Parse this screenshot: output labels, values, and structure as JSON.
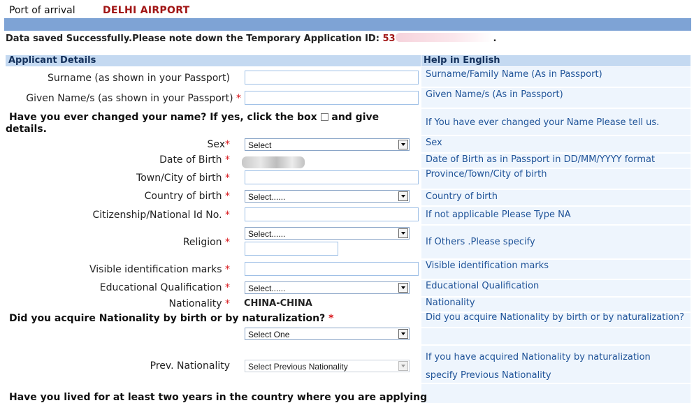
{
  "header": {
    "port_label": "Port of arrival",
    "port_value": "DELHI AIRPORT"
  },
  "notice": {
    "message": "Data saved Successfully.Please note down the Temporary Application ID:",
    "application_id_visible": "53",
    "application_id_end": "."
  },
  "sections": {
    "applicant": "Applicant Details",
    "help": "Help in English"
  },
  "required_mark": "*",
  "fields": {
    "surname": {
      "label": "Surname (as shown in your Passport)",
      "value": "",
      "help": "Surname/Family Name (As in Passport)"
    },
    "given_name": {
      "label": "Given Name/s (as shown in your Passport)",
      "value": "",
      "help": "Given Name/s (As in Passport)"
    },
    "changed_name": {
      "question_line1": "Have you ever changed your name? If yes, click the box",
      "question_tail": "and give",
      "question_line2": "details.",
      "help": "If You have ever changed your Name Please tell us."
    },
    "sex": {
      "label": "Sex",
      "selected": "Select",
      "help": "Sex"
    },
    "dob": {
      "label": "Date of Birth",
      "help": "Date of Birth as in Passport in DD/MM/YYYY format"
    },
    "birth_city": {
      "label": "Town/City of birth",
      "value": "",
      "help": "Province/Town/City of birth"
    },
    "birth_country": {
      "label": "Country of birth",
      "selected": "Select......",
      "help": "Country of birth"
    },
    "national_id": {
      "label": "Citizenship/National Id No.",
      "value": "",
      "help": "If not applicable Please Type NA"
    },
    "religion": {
      "label": "Religion",
      "selected": "Select......",
      "other_value": "",
      "help": "If Others .Please specify"
    },
    "id_marks": {
      "label": "Visible identification marks",
      "value": "",
      "help": "Visible identification marks"
    },
    "education": {
      "label": "Educational Qualification",
      "selected": "Select......",
      "help": "Educational Qualification"
    },
    "nationality": {
      "label": "Nationality",
      "value": "CHINA-CHINA",
      "help": "Nationality"
    },
    "nationality_acquired": {
      "question": "Did you acquire Nationality by birth or by naturalization?",
      "selected": "Select One",
      "help": "Did you acquire Nationality by birth or by naturalization?"
    },
    "prev_nationality": {
      "label": "Prev. Nationality",
      "selected": "Select Previous Nationality",
      "help_line1": "If you have acquired Nationality by naturalization",
      "help_line2": "specify Previous Nationality"
    },
    "lived_two_years": {
      "question": "Have you lived for at least two years in the country where you are applying"
    }
  }
}
